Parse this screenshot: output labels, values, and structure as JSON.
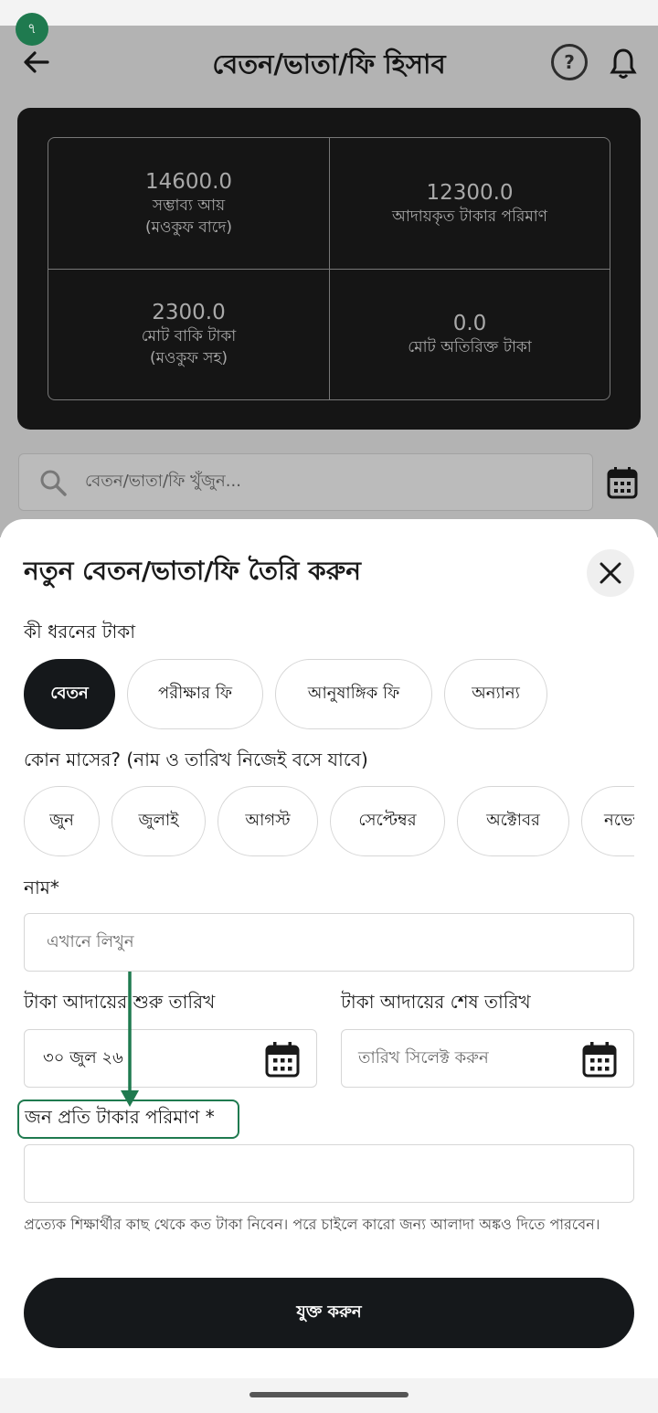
{
  "step_badge": "৭",
  "header": {
    "title": "বেতন/ভাতা/ফি হিসাব",
    "help_glyph": "?",
    "back_icon": "arrow-left-icon",
    "help_icon": "question-circle-icon",
    "bell_icon": "bell-icon"
  },
  "stats": [
    {
      "value": "14600.0",
      "label1": "সম্ভাব্য আয়",
      "label2": "(মওকুফ বাদে)"
    },
    {
      "value": "12300.0",
      "label1": "আদায়কৃত টাকার পরিমাণ",
      "label2": ""
    },
    {
      "value": "2300.0",
      "label1": "মোট বাকি টাকা",
      "label2": "(মওকুফ সহ)"
    },
    {
      "value": "0.0",
      "label1": "মোট অতিরিক্ত টাকা",
      "label2": ""
    }
  ],
  "search": {
    "placeholder": "বেতন/ভাতা/ফি খুঁজুন..."
  },
  "sheet": {
    "title": "নতুন বেতন/ভাতা/ফি তৈরি করুন",
    "type_label": "কী ধরনের টাকা",
    "types": [
      "বেতন",
      "পরীক্ষার ফি",
      "আনুষাঙ্গিক ফি",
      "অন্যান্য"
    ],
    "selected_type": "বেতন",
    "month_label": "কোন মাসের? (নাম ও তারিখ নিজেই বসে যাবে)",
    "months": [
      "জুন",
      "জুলাই",
      "আগস্ট",
      "সেপ্টেম্বর",
      "অক্টোবর",
      "নভেম্বর"
    ],
    "name_label": "নাম*",
    "name_placeholder": "এখানে লিখুন",
    "start_date_label": "টাকা আদায়ের শুরু তারিখ",
    "start_date_value": "৩০ জুল ২৬",
    "end_date_label": "টাকা আদায়ের শেষ তারিখ",
    "end_date_placeholder": "তারিখ সিলেক্ট করুন",
    "amount_label": "জন প্রতি টাকার পরিমাণ *",
    "amount_value": "",
    "helper_text": "প্রত্যেক শিক্ষার্থীর কাছ থেকে কত টাকা নিবেন। পরে চাইলে কারো জন্য আলাদা অঙ্কও দিতে পারবেন।",
    "submit_label": "যুক্ত করুন"
  },
  "colors": {
    "accent_green": "#1f7a4f",
    "dark": "#15181b",
    "card": "#1b1b1b"
  }
}
